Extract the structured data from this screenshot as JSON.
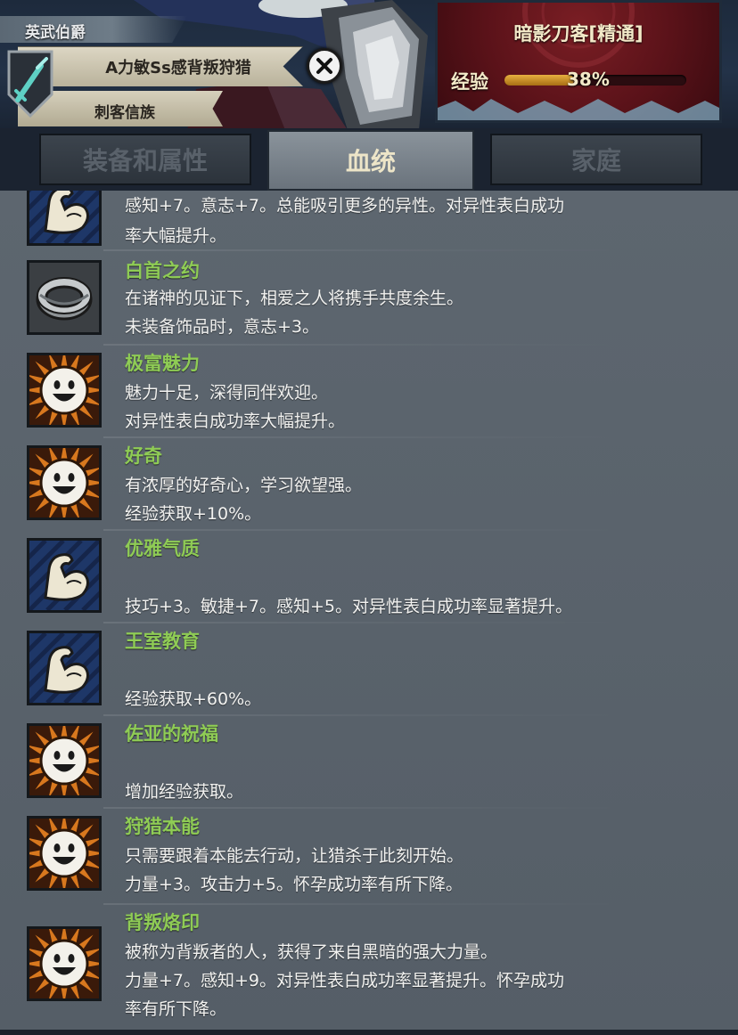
{
  "header": {
    "title": "英武伯爵",
    "traits": "A力敏Ss感背叛狩猎",
    "clan": "刺客信族",
    "class_name": "暗影刀客[精通]",
    "exp_label": "经验",
    "exp_value": "38%",
    "exp_fraction": 0.38
  },
  "tabs": [
    {
      "label": "装备和属性",
      "active": false
    },
    {
      "label": "血统",
      "active": true
    },
    {
      "label": "家庭",
      "active": false
    }
  ],
  "bloodline": [
    {
      "icon": "muscle-arm-icon",
      "name": "",
      "lines": [
        "感知+7。意志+7。总能吸引更多的异性。对异性表白成功",
        "率大幅提升。"
      ]
    },
    {
      "icon": "ring-icon",
      "name": "白首之约",
      "lines": [
        "在诸神的见证下，相爱之人将携手共度余生。",
        "未装备饰品时，意志+3。"
      ]
    },
    {
      "icon": "smiley-sun-icon",
      "name": "极富魅力",
      "lines": [
        "魅力十足，深得同伴欢迎。",
        "对异性表白成功率大幅提升。"
      ]
    },
    {
      "icon": "smiley-sun-icon",
      "name": "好奇",
      "lines": [
        "有浓厚的好奇心，学习欲望强。",
        "经验获取+10%。"
      ]
    },
    {
      "icon": "muscle-arm-icon",
      "name": "优雅气质",
      "lines": [
        "",
        "技巧+3。敏捷+7。感知+5。对异性表白成功率显著提升。"
      ]
    },
    {
      "icon": "muscle-arm-icon",
      "name": "王室教育",
      "lines": [
        "",
        "经验获取+60%。"
      ]
    },
    {
      "icon": "smiley-sun-icon",
      "name": "佐亚的祝福",
      "lines": [
        "",
        "增加经验获取。"
      ]
    },
    {
      "icon": "smiley-sun-icon",
      "name": "狩猎本能",
      "lines": [
        "只需要跟着本能去行动，让猎杀于此刻开始。",
        "力量+3。攻击力+5。怀孕成功率有所下降。"
      ]
    },
    {
      "icon": "smiley-sun-icon",
      "name": "背叛烙印",
      "lines": [
        "被称为背叛者的人，获得了来自黑暗的强大力量。",
        "力量+7。感知+9。对异性表白成功率显著提升。怀孕成功",
        "率有所下降。"
      ]
    }
  ]
}
